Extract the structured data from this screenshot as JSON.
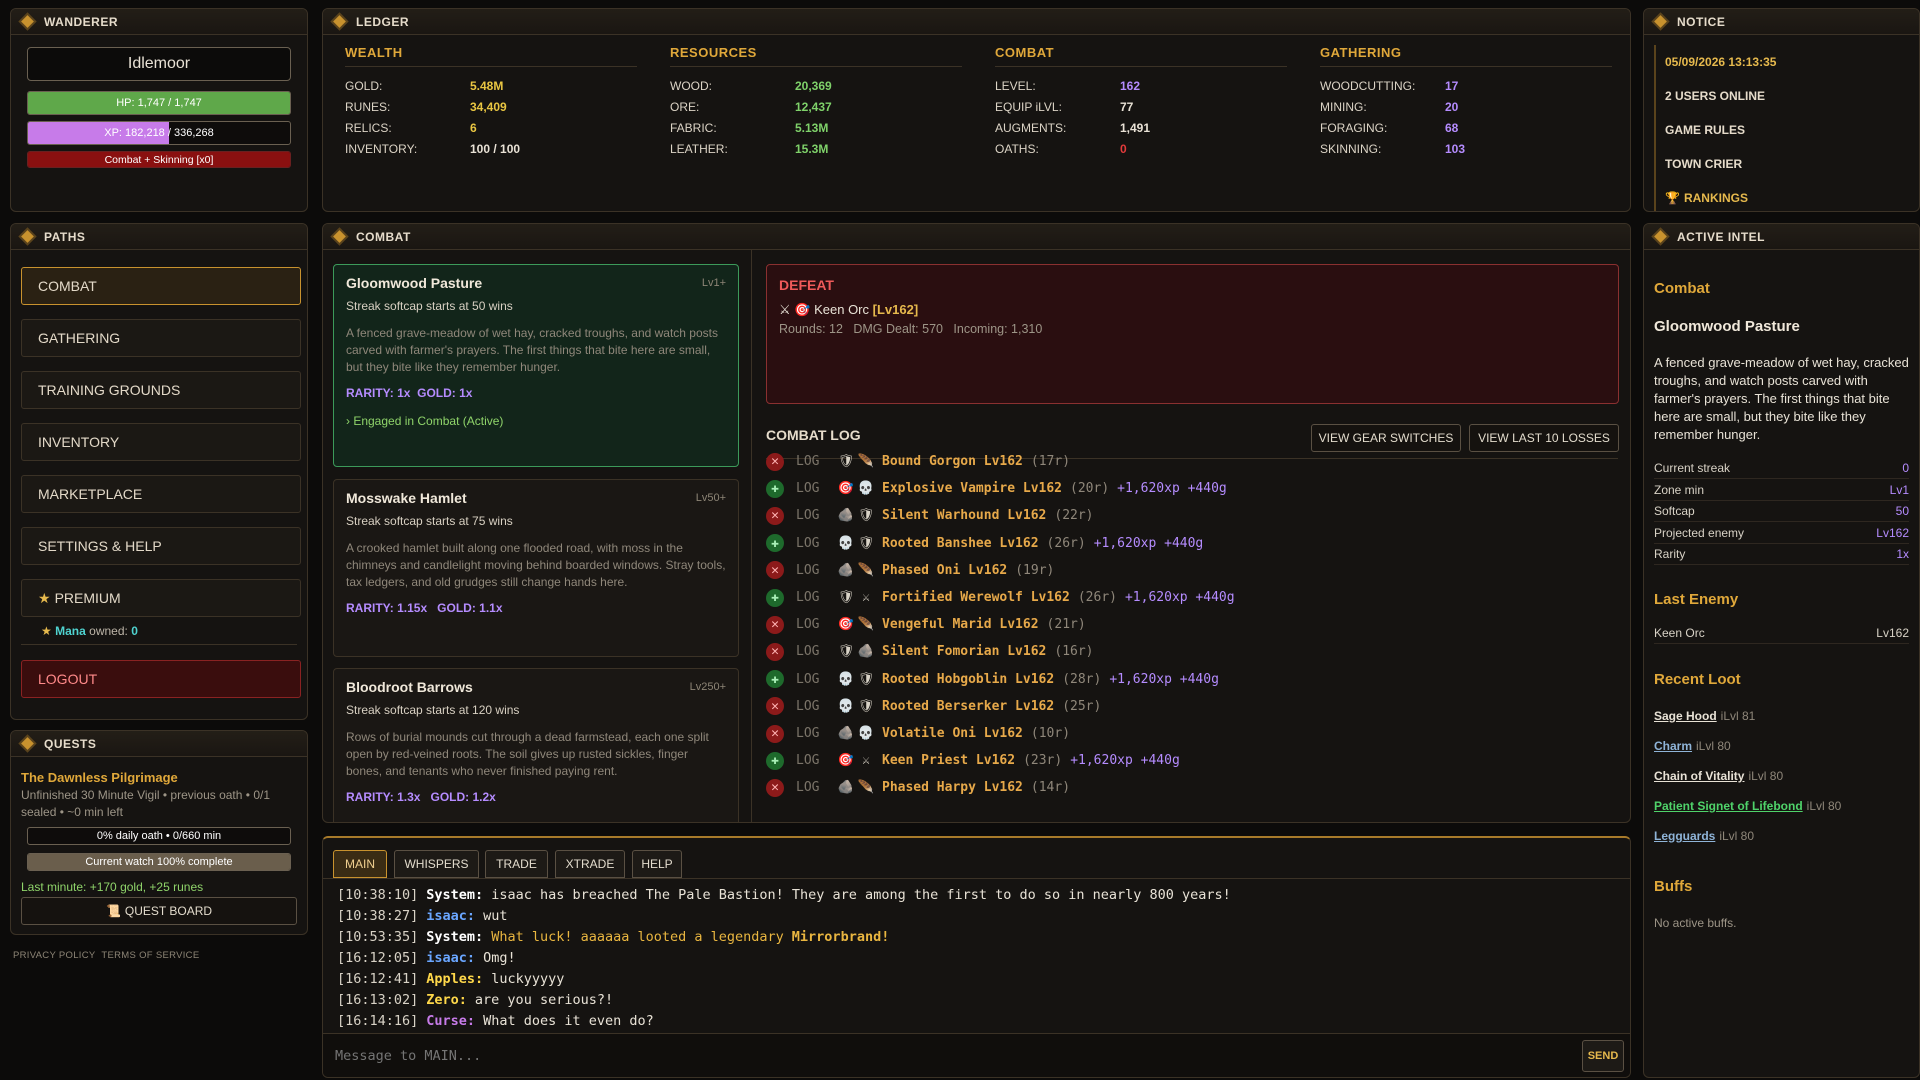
{
  "wanderer": {
    "title": "WANDERER",
    "name": "Idlemoor",
    "hp_text": "HP: 1,747 / 1,747",
    "hp_fraction": 1.0,
    "xp_text": "XP: 182,218 / 336,268",
    "xp_fraction": 0.54,
    "skill_text": "Combat + Skinning [x0]",
    "colors": {
      "hp": "#5fa84a",
      "xp": "#c77be9",
      "skill": "#8a1010"
    }
  },
  "ledger": {
    "title": "LEDGER",
    "columns": [
      {
        "heading": "WEALTH",
        "rows": [
          {
            "k": "GOLD:",
            "v": "5.48M",
            "c": "#e9c642"
          },
          {
            "k": "RUNES:",
            "v": "34,409",
            "c": "#e9c642"
          },
          {
            "k": "RELICS:",
            "v": "6",
            "c": "#e9c642"
          },
          {
            "k": "INVENTORY:",
            "v": "100 / 100",
            "c": "#e9e2d6"
          }
        ]
      },
      {
        "heading": "RESOURCES",
        "rows": [
          {
            "k": "WOOD:",
            "v": "20,369",
            "c": "#7fd26a"
          },
          {
            "k": "ORE:",
            "v": "12,437",
            "c": "#7fd26a"
          },
          {
            "k": "FABRIC:",
            "v": "5.13M",
            "c": "#7fd26a"
          },
          {
            "k": "LEATHER:",
            "v": "15.3M",
            "c": "#7fd26a"
          }
        ]
      },
      {
        "heading": "COMBAT",
        "rows": [
          {
            "k": "LEVEL:",
            "v": "162",
            "c": "#b58cff"
          },
          {
            "k": "EQUIP iLVL:",
            "v": "77",
            "c": "#e9e2d6"
          },
          {
            "k": "AUGMENTS:",
            "v": "1,491",
            "c": "#e9e2d6"
          },
          {
            "k": "OATHS:",
            "v": "0",
            "c": "#e33b3b"
          }
        ]
      },
      {
        "heading": "GATHERING",
        "rows": [
          {
            "k": "WOODCUTTING:",
            "v": "17",
            "c": "#b58cff"
          },
          {
            "k": "MINING:",
            "v": "20",
            "c": "#b58cff"
          },
          {
            "k": "FORAGING:",
            "v": "68",
            "c": "#b58cff"
          },
          {
            "k": "SKINNING:",
            "v": "103",
            "c": "#b58cff"
          }
        ]
      }
    ]
  },
  "notice": {
    "title": "NOTICE",
    "datetime": "05/09/2026 13:13:35",
    "users_online": "2 USERS ONLINE",
    "game_rules": "GAME RULES",
    "town_crier": "TOWN CRIER",
    "rankings": "RANKINGS"
  },
  "paths": {
    "title": "PATHS",
    "items": [
      "COMBAT",
      "GATHERING",
      "TRAINING GROUNDS",
      "INVENTORY",
      "MARKETPLACE",
      "SETTINGS & HELP",
      "PREMIUM"
    ],
    "mana_label": "Mana",
    "mana_owned_label": "owned:",
    "mana_value": "0",
    "logout": "LOGOUT"
  },
  "quests": {
    "title": "QUESTS",
    "quest_name": "The Dawnless Pilgrimage",
    "quest_desc": "Unfinished 30 Minute Vigil • previous oath • 0/1 sealed • ~0 min left",
    "daily_text": "0% daily oath • 0/660 min",
    "watch_text": "Current watch 100% complete",
    "watch_fraction": 1.0,
    "last_minute": "Last minute: +170 gold, +25 runes",
    "board": "QUEST BOARD"
  },
  "footer": {
    "privacy": "PRIVACY POLICY",
    "terms": "TERMS OF SERVICE"
  },
  "combat": {
    "title": "COMBAT",
    "zones": [
      {
        "name": "Gloomwood Pasture",
        "lv": "Lv1+",
        "softcap": "Streak softcap starts at 50 wins",
        "desc": "A fenced grave-meadow of wet hay, cracked troughs, and watch posts carved with farmer's prayers. The first things that bite here are small, but they bite like they remember hunger.",
        "rarity": "RARITY: 1x",
        "gold": "GOLD: 1x",
        "status": "› Engaged in Combat (Active)"
      },
      {
        "name": "Mosswake Hamlet",
        "lv": "Lv50+",
        "softcap": "Streak softcap starts at 75 wins",
        "desc": "A crooked hamlet built along one flooded road, with moss in the chimneys and candlelight moving behind boarded windows. Stray tools, tax ledgers, and old grudges still change hands here.",
        "rarity": "RARITY: 1.15x",
        "gold": "GOLD: 1.1x"
      },
      {
        "name": "Bloodroot Barrows",
        "lv": "Lv250+",
        "softcap": "Streak softcap starts at 120 wins",
        "desc": "Rows of burial mounds cut through a dead farmstead, each one split open by red-veined roots. The soil gives up rusted sickles, finger bones, and tenants who never finished paying rent.",
        "rarity": "RARITY: 1.3x",
        "gold": "GOLD: 1.2x"
      }
    ],
    "result": {
      "title": "DEFEAT",
      "enemy": "Keen Orc",
      "enemy_lv": "[Lv162]",
      "stats": "Rounds: 12   DMG Dealt: 570   Incoming: 1,310"
    },
    "log_title": "COMBAT LOG",
    "gear_btn": "VIEW GEAR SWITCHES",
    "losses_btn": "VIEW LAST 10 LOSSES",
    "log": [
      {
        "win": false,
        "tag": "LOG",
        "i1": "🛡",
        "i2": "🪶",
        "enemy": "Bound Gorgon Lv162",
        "rounds": "(17r)",
        "reward": ""
      },
      {
        "win": true,
        "tag": "LOG",
        "i1": "🎯",
        "i2": "💀",
        "enemy": "Explosive Vampire Lv162",
        "rounds": "(20r)",
        "reward": "+1,620xp +440g"
      },
      {
        "win": false,
        "tag": "LOG",
        "i1": "🪨",
        "i2": "🛡",
        "enemy": "Silent Warhound Lv162",
        "rounds": "(22r)",
        "reward": ""
      },
      {
        "win": true,
        "tag": "LOG",
        "i1": "💀",
        "i2": "🛡",
        "enemy": "Rooted Banshee Lv162",
        "rounds": "(26r)",
        "reward": "+1,620xp +440g"
      },
      {
        "win": false,
        "tag": "LOG",
        "i1": "🪨",
        "i2": "🪶",
        "enemy": "Phased Oni Lv162",
        "rounds": "(19r)",
        "reward": ""
      },
      {
        "win": true,
        "tag": "LOG",
        "i1": "🛡",
        "i2": "⚔",
        "enemy": "Fortified Werewolf Lv162",
        "rounds": "(26r)",
        "reward": "+1,620xp +440g"
      },
      {
        "win": false,
        "tag": "LOG",
        "i1": "🎯",
        "i2": "🪶",
        "enemy": "Vengeful Marid Lv162",
        "rounds": "(21r)",
        "reward": ""
      },
      {
        "win": false,
        "tag": "LOG",
        "i1": "🛡",
        "i2": "🪨",
        "enemy": "Silent Fomorian Lv162",
        "rounds": "(16r)",
        "reward": ""
      },
      {
        "win": true,
        "tag": "LOG",
        "i1": "💀",
        "i2": "🛡",
        "enemy": "Rooted Hobgoblin Lv162",
        "rounds": "(28r)",
        "reward": "+1,620xp +440g"
      },
      {
        "win": false,
        "tag": "LOG",
        "i1": "💀",
        "i2": "🛡",
        "enemy": "Rooted Berserker Lv162",
        "rounds": "(25r)",
        "reward": ""
      },
      {
        "win": false,
        "tag": "LOG",
        "i1": "🪨",
        "i2": "💀",
        "enemy": "Volatile Oni Lv162",
        "rounds": "(10r)",
        "reward": ""
      },
      {
        "win": true,
        "tag": "LOG",
        "i1": "🎯",
        "i2": "⚔",
        "enemy": "Keen Priest Lv162",
        "rounds": "(23r)",
        "reward": "+1,620xp +440g"
      },
      {
        "win": false,
        "tag": "LOG",
        "i1": "🪨",
        "i2": "🪶",
        "enemy": "Phased Harpy Lv162",
        "rounds": "(14r)",
        "reward": ""
      }
    ]
  },
  "chat": {
    "tabs": [
      "MAIN",
      "WHISPERS",
      "TRADE",
      "XTRADE",
      "HELP"
    ],
    "lines": [
      {
        "t": "[10:38:10]",
        "u": "System:",
        "uc": "#ffffff",
        "m": "isaac has breached The Pale Bastion! They are among the first to do so in nearly 800 years!",
        "mc": "#e8e2d6",
        "hl": ""
      },
      {
        "t": "[10:38:27]",
        "u": "isaac:",
        "uc": "#6aa6ff",
        "m": "wut",
        "mc": "#e8e2d6",
        "hl": ""
      },
      {
        "t": "[10:53:35]",
        "u": "System:",
        "uc": "#ffffff",
        "m": "What luck! aaaaaa looted a legendary",
        "mc": "#e9b640",
        "hl": "Mirrorbrand!"
      },
      {
        "t": "[16:12:05]",
        "u": "isaac:",
        "uc": "#6aa6ff",
        "m": "Omg!",
        "mc": "#e8e2d6",
        "hl": ""
      },
      {
        "t": "[16:12:41]",
        "u": "Apples:",
        "uc": "#ffd84a",
        "m": "luckyyyyy",
        "mc": "#e8e2d6",
        "hl": ""
      },
      {
        "t": "[16:13:02]",
        "u": "Zero:",
        "uc": "#ffd84a",
        "m": "are you serious?!",
        "mc": "#e8e2d6",
        "hl": ""
      },
      {
        "t": "[16:14:16]",
        "u": "Curse:",
        "uc": "#c77be9",
        "m": "What does it even do?",
        "mc": "#e8e2d6",
        "hl": ""
      }
    ],
    "placeholder": "Message to MAIN...",
    "send": "SEND"
  },
  "intel": {
    "title": "ACTIVE INTEL",
    "section": "Combat",
    "zone": "Gloomwood Pasture",
    "desc": "A fenced grave-meadow of wet hay, cracked troughs, and watch posts carved with farmer's prayers. The first things that bite here are small, but they bite like they remember hunger.",
    "rows": [
      {
        "k": "Current streak",
        "v": "0"
      },
      {
        "k": "Zone min",
        "v": "Lv1"
      },
      {
        "k": "Softcap",
        "v": "50"
      },
      {
        "k": "Projected enemy",
        "v": "Lv162"
      },
      {
        "k": "Rarity",
        "v": "1x"
      }
    ],
    "last_enemy_title": "Last Enemy",
    "last_enemy": {
      "k": "Keen Orc",
      "v": "Lv162"
    },
    "loot_title": "Recent Loot",
    "loot": [
      {
        "n": "Sage Hood",
        "i": "iLvl 81",
        "c": "#e8e2d6"
      },
      {
        "n": "Charm",
        "i": "iLvl 80",
        "c": "#8fb4d8"
      },
      {
        "n": "Chain of Vitality",
        "i": "iLvl 80",
        "c": "#e8e2d6"
      },
      {
        "n": "Patient Signet of Lifebond",
        "i": "iLvl 80",
        "c": "#4fd36a"
      },
      {
        "n": "Legguards",
        "i": "iLvl 80",
        "c": "#8fb4d8"
      }
    ],
    "buffs_title": "Buffs",
    "buffs_text": "No active buffs."
  }
}
